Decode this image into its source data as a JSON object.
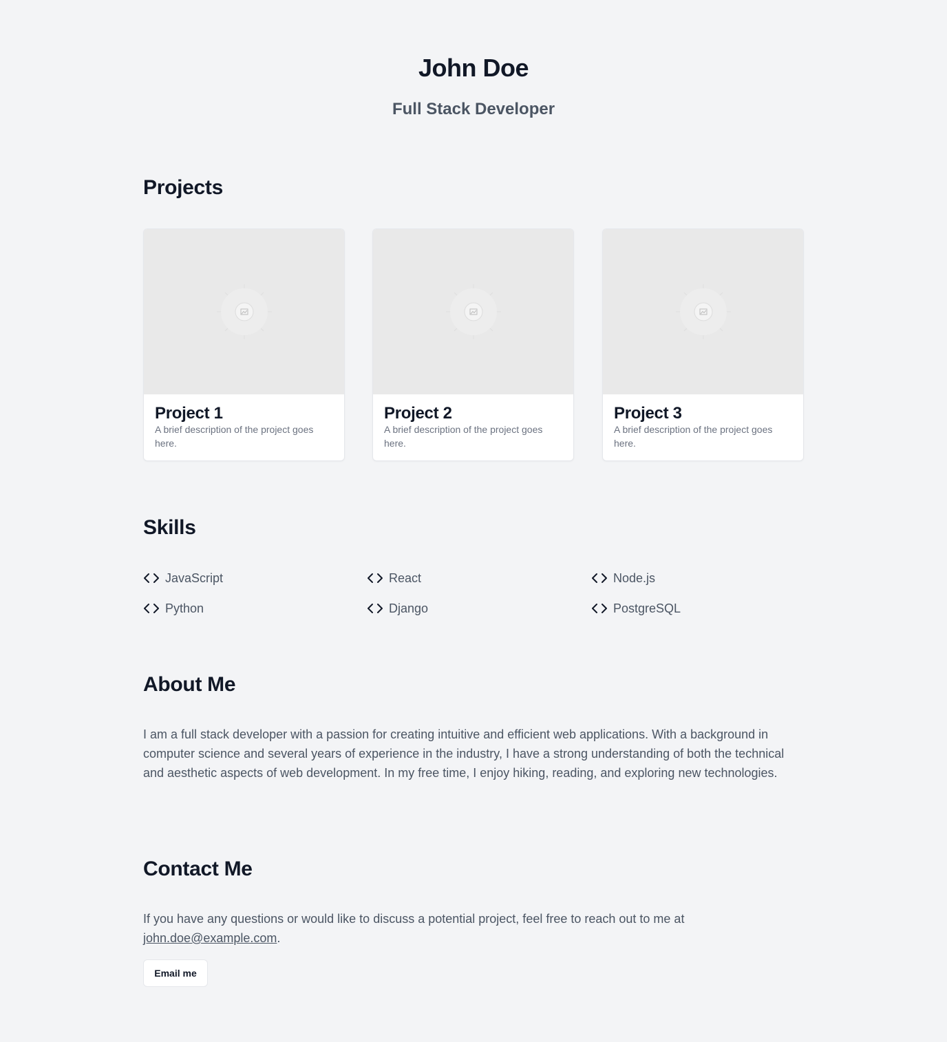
{
  "header": {
    "name": "John Doe",
    "role": "Full Stack Developer"
  },
  "projects": {
    "title": "Projects",
    "items": [
      {
        "title": "Project 1",
        "description": "A brief description of the project goes here.",
        "image_icon": "image-placeholder-icon"
      },
      {
        "title": "Project 2",
        "description": "A brief description of the project goes here.",
        "image_icon": "image-placeholder-icon"
      },
      {
        "title": "Project 3",
        "description": "A brief description of the project goes here.",
        "image_icon": "image-placeholder-icon"
      }
    ]
  },
  "skills": {
    "title": "Skills",
    "icon": "code-icon",
    "items": [
      "JavaScript",
      "React",
      "Node.js",
      "Python",
      "Django",
      "PostgreSQL"
    ]
  },
  "about": {
    "title": "About Me",
    "text": "I am a full stack developer with a passion for creating intuitive and efficient web applications. With a background in computer science and several years of experience in the industry, I have a strong understanding of both the technical and aesthetic aspects of web development. In my free time, I enjoy hiking, reading, and exploring new technologies."
  },
  "contact": {
    "title": "Contact Me",
    "text_before": "If you have any questions or would like to discuss a potential project, feel free to reach out to me at",
    "email": "john.doe@example.com",
    "text_after": ".",
    "button_label": "Email me"
  },
  "colors": {
    "background": "#f3f4f6",
    "heading": "#111827",
    "body_text": "#4b5563",
    "muted_text": "#6b7280",
    "card_bg": "#ffffff",
    "thumb_bg": "#e9e9e9"
  }
}
